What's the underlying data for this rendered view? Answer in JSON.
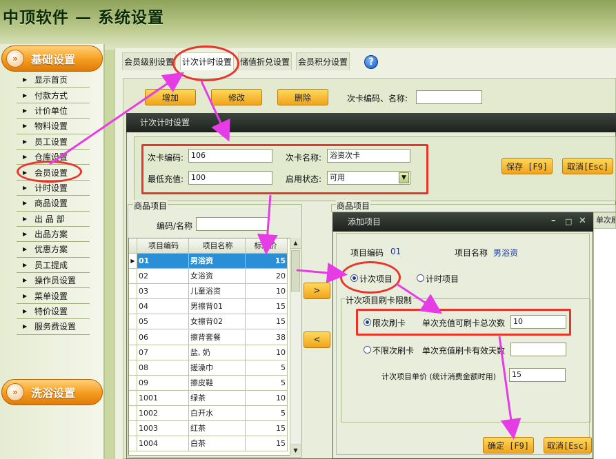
{
  "app": {
    "title": "中顶软件 — 系统设置"
  },
  "sidebar": {
    "section1": "基础设置",
    "section2": "洗浴设置",
    "items": [
      "显示首页",
      "付款方式",
      "计价单位",
      "物料设置",
      "员工设置",
      "仓库设置",
      "会员设置",
      "计时设置",
      "商品设置",
      "出 品 部",
      "出品方案",
      "优惠方案",
      "员工提成",
      "操作员设置",
      "菜单设置",
      "特价设置",
      "服务费设置"
    ]
  },
  "tabs": [
    "会员级别设置",
    "计次计时设置",
    "储值折兑设置",
    "会员积分设置"
  ],
  "toolbar": {
    "add": "增加",
    "edit": "修改",
    "delete": "删除",
    "search_label": "次卡编码、名称:",
    "search_value": ""
  },
  "dlg1": {
    "title": "计次计时设置",
    "card_code_label": "次卡编码:",
    "card_code": "106",
    "card_name_label": "次卡名称:",
    "card_name": "浴资次卡",
    "min_recharge_label": "最低充值:",
    "min_recharge": "100",
    "status_label": "启用状态:",
    "status": "可用",
    "save": "保存 [F9]",
    "cancel": "取消[Esc]",
    "goods_group": "商品项目",
    "goods_group2": "商品项目",
    "filter_label": "编码/名称",
    "filter_value": "",
    "right_col_partial": "单次刷",
    "move_right": ">",
    "move_left": "<"
  },
  "grid": {
    "headers": [
      "项目编码",
      "项目名称",
      "标准价"
    ],
    "rows": [
      [
        "01",
        "男浴资",
        "15"
      ],
      [
        "02",
        "女浴资",
        "20"
      ],
      [
        "03",
        "儿童浴资",
        "10"
      ],
      [
        "04",
        "男擦背01",
        "15"
      ],
      [
        "05",
        "女擦背02",
        "15"
      ],
      [
        "06",
        "擦背套餐",
        "38"
      ],
      [
        "07",
        "盐, 奶",
        "10"
      ],
      [
        "08",
        "搓澡巾",
        "5"
      ],
      [
        "09",
        "擦皮鞋",
        "5"
      ],
      [
        "1001",
        "绿茶",
        "10"
      ],
      [
        "1002",
        "白开水",
        "5"
      ],
      [
        "1003",
        "红茶",
        "15"
      ],
      [
        "1004",
        "白茶",
        "15"
      ]
    ]
  },
  "dlg2": {
    "title": "添加项目",
    "item_code_label": "项目编码",
    "item_code": "01",
    "item_name_label": "项目名称",
    "item_name": "男浴资",
    "type_count": "计次项目",
    "type_time": "计时项目",
    "limit_group": "计次项目刷卡限制",
    "limited": "限次刷卡",
    "limited_desc": "单次充值可刷卡总次数",
    "limited_value": "10",
    "unlimited": "不限次刷卡",
    "unlimited_desc": "单次充值刷卡有效天数",
    "unlimited_value": "",
    "unit_price_label": "计次项目单价 (统计消费金额时用)",
    "unit_price": "15",
    "ok": "确定 [F9]",
    "cancel": "取消[Esc]"
  },
  "colors": {
    "annotation_red": "#e8342a",
    "annotation_magenta": "#e63ce6",
    "accent_orange": "#f0a41c",
    "selection_blue": "#2a8fd6"
  }
}
